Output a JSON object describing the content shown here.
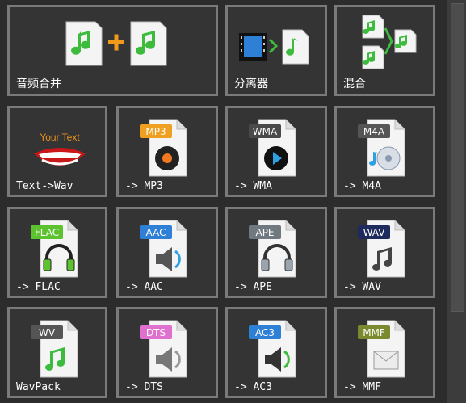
{
  "tiles": {
    "audio_merge": "音频合并",
    "splitter": "分离器",
    "mix": "混合",
    "text_to_wav": "Text->Wav",
    "to_mp3": "-> MP3",
    "to_wma": "-> WMA",
    "to_m4a": "-> M4A",
    "to_flac": "-> FLAC",
    "to_aac": "-> AAC",
    "to_ape": "-> APE",
    "to_wav": "-> WAV",
    "wavpack": "WavPack",
    "to_dts": "-> DTS",
    "to_ac3": "-> AC3",
    "to_mmf": "-> MMF"
  },
  "icons": {
    "your_text": "Your Text",
    "mp3": "MP3",
    "wma": "WMA",
    "m4a": "M4A",
    "flac": "FLAC",
    "aac": "AAC",
    "ape": "APE",
    "wav": "WAV",
    "wv": "WV",
    "dts": "DTS",
    "ac3": "AC3",
    "mmf": "MMF"
  },
  "colors": {
    "mp3": "#f0a020",
    "wma": "#4a4a4a",
    "m4a": "#555555",
    "flac": "#5cc32e",
    "aac": "#2e7fd6",
    "ape": "#707880",
    "wav": "#1f2b5c",
    "wv": "#555555",
    "dts": "#e070d0",
    "ac3": "#2e7fd6",
    "mmf": "#7a8a30",
    "note_green": "#3dbb3d",
    "plus_orange": "#f29a1a"
  }
}
